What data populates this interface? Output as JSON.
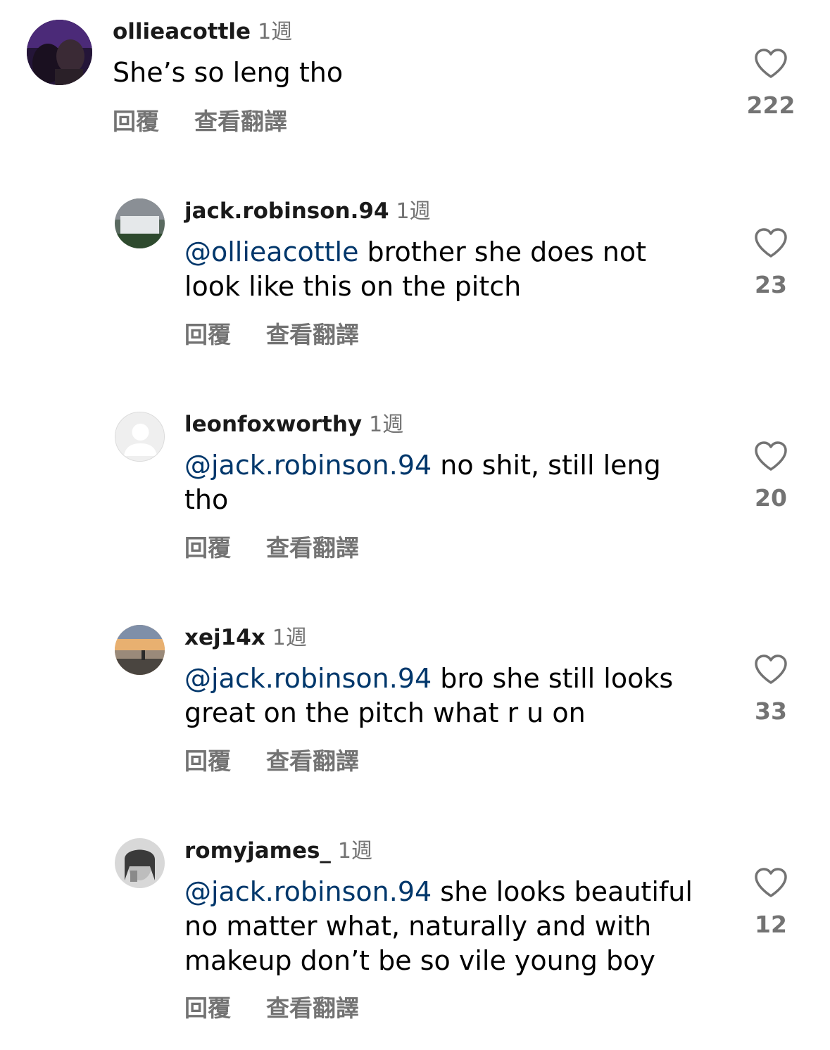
{
  "colors": {
    "mention": "#00376b",
    "secondary_text": "#737373",
    "primary_text": "#000000"
  },
  "comments": [
    {
      "username": "ollieacottle",
      "time": "1週",
      "mention": "",
      "text": "She’s so leng tho",
      "reply_label": "回覆",
      "translate_label": "查看翻譯",
      "likes": "222",
      "avatar_icon": "avatar-photo-dark-purple"
    },
    {
      "username": "jack.robinson.94",
      "time": "1週",
      "mention": "@ollieacottle",
      "text": " brother she does not look like this on the pitch",
      "reply_label": "回覆",
      "translate_label": "查看翻譯",
      "likes": "23",
      "avatar_icon": "avatar-photo-stadium"
    },
    {
      "username": "leonfoxworthy",
      "time": "1週",
      "mention": "@jack.robinson.94",
      "text": " no shit, still leng tho",
      "reply_label": "回覆",
      "translate_label": "查看翻譯",
      "likes": "20",
      "avatar_icon": "default-avatar-icon"
    },
    {
      "username": "xej14x",
      "time": "1週",
      "mention": "@jack.robinson.94",
      "text": " bro she still looks great on the pitch what r u on",
      "reply_label": "回覆",
      "translate_label": "查看翻譯",
      "likes": "33",
      "avatar_icon": "avatar-photo-sunset"
    },
    {
      "username": "romyjames_",
      "time": "1週",
      "mention": "@jack.robinson.94",
      "text": " she looks beautiful no matter what, naturally and with makeup don’t be so vile young boy",
      "reply_label": "回覆",
      "translate_label": "查看翻譯",
      "likes": "12",
      "avatar_icon": "avatar-photo-portrait"
    }
  ]
}
